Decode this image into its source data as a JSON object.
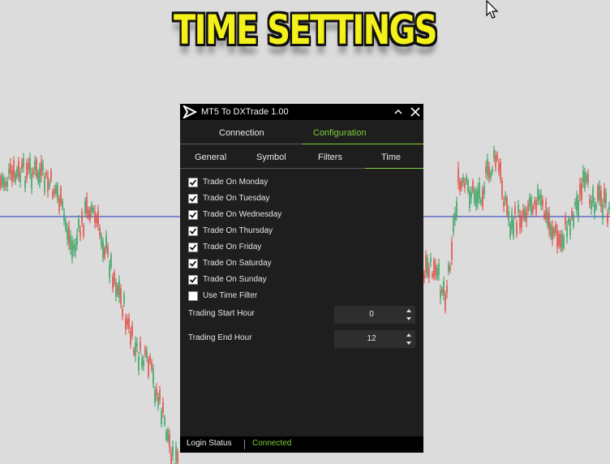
{
  "banner": {
    "text": "TIME SETTINGS"
  },
  "window": {
    "title": "MT5 To DXTrade 1.00"
  },
  "main_tabs": [
    {
      "label": "Connection",
      "active": false
    },
    {
      "label": "Configuration",
      "active": true
    }
  ],
  "sub_tabs": [
    {
      "label": "General",
      "active": false
    },
    {
      "label": "Symbol",
      "active": false
    },
    {
      "label": "Filters",
      "active": false
    },
    {
      "label": "Time",
      "active": true
    }
  ],
  "checkboxes": [
    {
      "label": "Trade On Monday",
      "checked": true
    },
    {
      "label": "Trade On Tuesday",
      "checked": true
    },
    {
      "label": "Trade On Wednesday",
      "checked": true
    },
    {
      "label": "Trade On Thursday",
      "checked": true
    },
    {
      "label": "Trade On Friday",
      "checked": true
    },
    {
      "label": "Trade On Saturday",
      "checked": true
    },
    {
      "label": "Trade On Sunday",
      "checked": true
    },
    {
      "label": "Use Time Filter",
      "checked": false
    }
  ],
  "fields": {
    "start_label": "Trading Start Hour",
    "start_value": "0",
    "end_label": "Trading End Hour",
    "end_value": "12"
  },
  "status": {
    "label": "Login Status",
    "value": "Connected"
  },
  "colors": {
    "accent": "#7fd03a",
    "panel": "#1e1e1e",
    "banner": "#f3f01a",
    "candle_up": "#2e9e5a",
    "candle_down": "#e0443a",
    "hline": "#1f2fbf"
  }
}
